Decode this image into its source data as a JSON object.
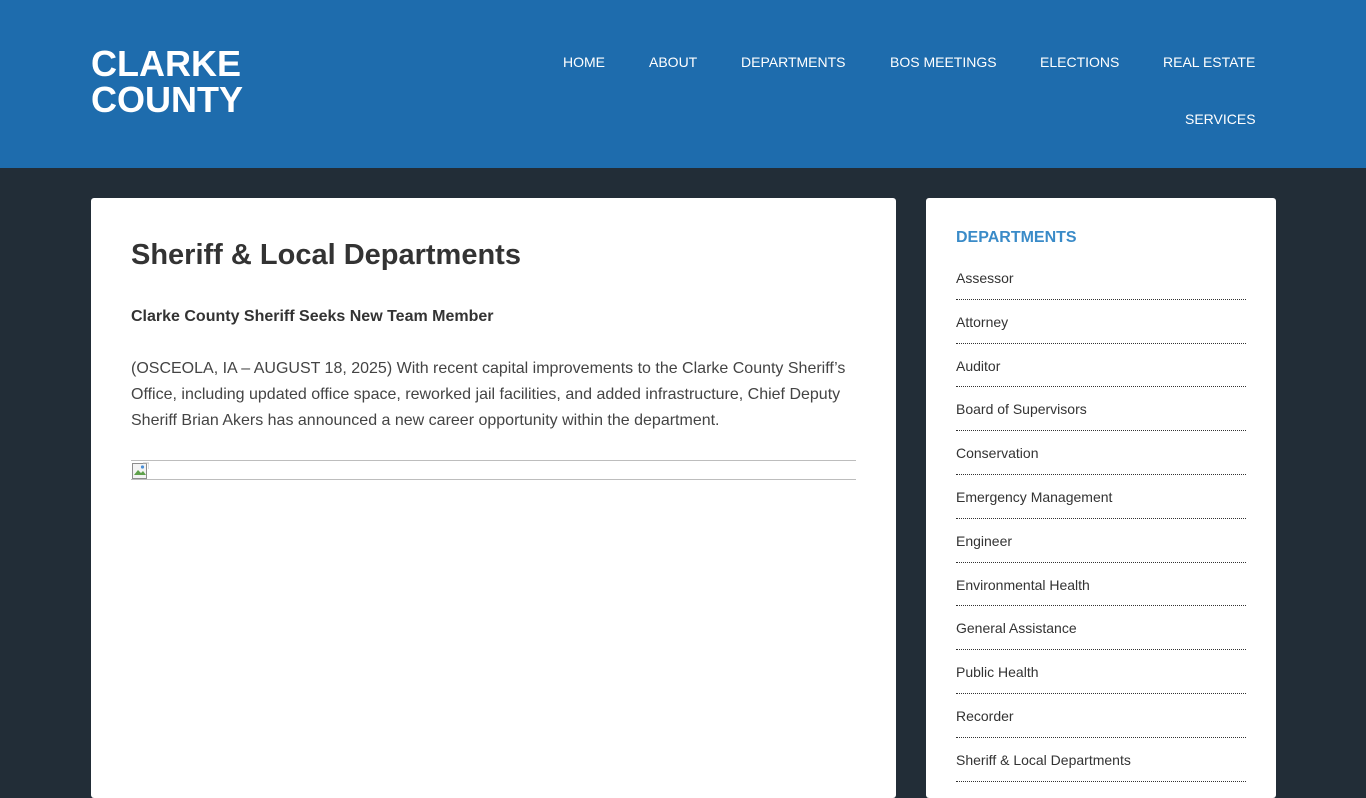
{
  "site": {
    "title_line1": "CLARKE",
    "title_line2": "COUNTY"
  },
  "nav": {
    "items": [
      {
        "label": "HOME"
      },
      {
        "label": "ABOUT"
      },
      {
        "label": "DEPARTMENTS"
      },
      {
        "label": "BOS MEETINGS"
      },
      {
        "label": "ELECTIONS"
      },
      {
        "label": "REAL ESTATE"
      },
      {
        "label": "SERVICES"
      }
    ]
  },
  "article": {
    "title": "Sheriff & Local Departments",
    "subheading": "Clarke County Sheriff Seeks New Team Member",
    "body": "(OSCEOLA, IA – AUGUST 18, 2025) With recent capital improvements to the Clarke County Sheriff’s Office, including updated office space, reworked jail facilities, and added infrastructure, Chief Deputy Sheriff Brian Akers has announced a new career opportunity within the department."
  },
  "sidebar": {
    "title": "DEPARTMENTS",
    "items": [
      {
        "label": "Assessor"
      },
      {
        "label": "Attorney"
      },
      {
        "label": "Auditor"
      },
      {
        "label": "Board of Supervisors"
      },
      {
        "label": "Conservation"
      },
      {
        "label": "Emergency Management"
      },
      {
        "label": "Engineer"
      },
      {
        "label": "Environmental Health"
      },
      {
        "label": "General Assistance"
      },
      {
        "label": "Public Health"
      },
      {
        "label": "Recorder"
      },
      {
        "label": "Sheriff & Local Departments"
      }
    ]
  },
  "colors": {
    "header_bg": "#1e6cad",
    "page_bg": "#222d37",
    "accent": "#3a8bc8",
    "text": "#333333"
  },
  "icons": {
    "broken_image": "broken-image-icon"
  }
}
